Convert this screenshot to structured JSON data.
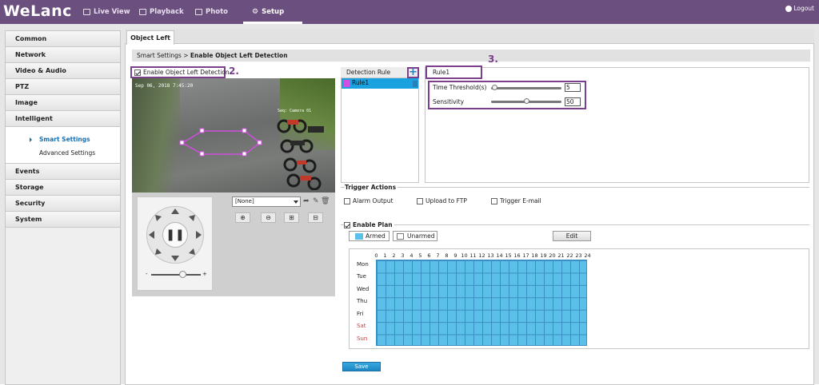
{
  "app": {
    "logo": "WeLanc",
    "logout": "Logout"
  },
  "nav": {
    "live_view": "Live View",
    "playback": "Playback",
    "photo": "Photo",
    "setup": "Setup"
  },
  "sidebar": {
    "items": [
      "Common",
      "Network",
      "Video & Audio",
      "PTZ",
      "Image",
      "Intelligent"
    ],
    "intelligent_sub": [
      "Smart Settings",
      "Advanced Settings"
    ],
    "items_after": [
      "Events",
      "Storage",
      "Security",
      "System"
    ]
  },
  "tab": "Object Left",
  "breadcrumb": {
    "parent": "Smart Settings",
    "sep": ">",
    "current": "Enable Object Left Detection"
  },
  "enable_label": "Enable Object Left Detection",
  "steps": {
    "s2": "2.",
    "s3": "3."
  },
  "video": {
    "osd_time": "Sep 06, 2018 7:45:20",
    "osd_cam": "Seq: Camera 01"
  },
  "ptz": {
    "preset": "[None]"
  },
  "rules": {
    "header": "Detection Rule",
    "add": "+",
    "items": [
      "Rule1"
    ],
    "selected": "Rule1"
  },
  "rule_settings": {
    "title": "Rule1",
    "time_threshold": {
      "label": "Time Threshold(s)",
      "value": "5",
      "fraction": 0.05
    },
    "sensitivity": {
      "label": "Sensitivity",
      "value": "50",
      "fraction": 0.5
    }
  },
  "trigger": {
    "title": "Trigger Actions",
    "alarm_output": "Alarm Output",
    "upload_ftp": "Upload to FTP",
    "trigger_email": "Trigger E-mail"
  },
  "plan": {
    "title": "Enable Plan",
    "armed": "Armed",
    "unarmed": "Unarmed",
    "edit": "Edit",
    "hours": [
      "0",
      "1",
      "2",
      "3",
      "4",
      "5",
      "6",
      "7",
      "8",
      "9",
      "10",
      "11",
      "12",
      "13",
      "14",
      "15",
      "16",
      "17",
      "18",
      "19",
      "20",
      "21",
      "22",
      "23",
      "24"
    ],
    "days": [
      "Mon",
      "Tue",
      "Wed",
      "Thu",
      "Fri",
      "Sat",
      "Sun"
    ],
    "armed_color": "#5bc0e8"
  },
  "save": "Save",
  "colors": {
    "header": "#6b4f7e",
    "annotation": "#7b3f8c",
    "selected_rule": "#1aa2e0",
    "weekend": "#e23030"
  }
}
